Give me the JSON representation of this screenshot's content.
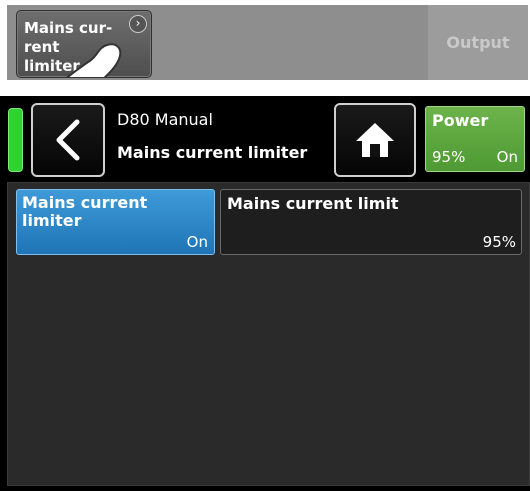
{
  "top_bar": {
    "button_label": "Mains cur-\nrent limiter",
    "output_label": "Output",
    "icon": "chevron-right-icon"
  },
  "header": {
    "device_name": "D80 Manual",
    "page_title": "Mains current limiter",
    "back_icon": "chevron-left-icon",
    "home_icon": "home-icon"
  },
  "power": {
    "label": "Power",
    "value": "95%",
    "state": "On"
  },
  "tiles": {
    "limiter": {
      "label": "Mains current limiter",
      "value": "On"
    },
    "limit": {
      "label": "Mains current limit",
      "value": "95%"
    }
  },
  "colors": {
    "led": "#2fd22f",
    "power_bg": "#5da63f",
    "tile_blue": "#2a86c8"
  }
}
